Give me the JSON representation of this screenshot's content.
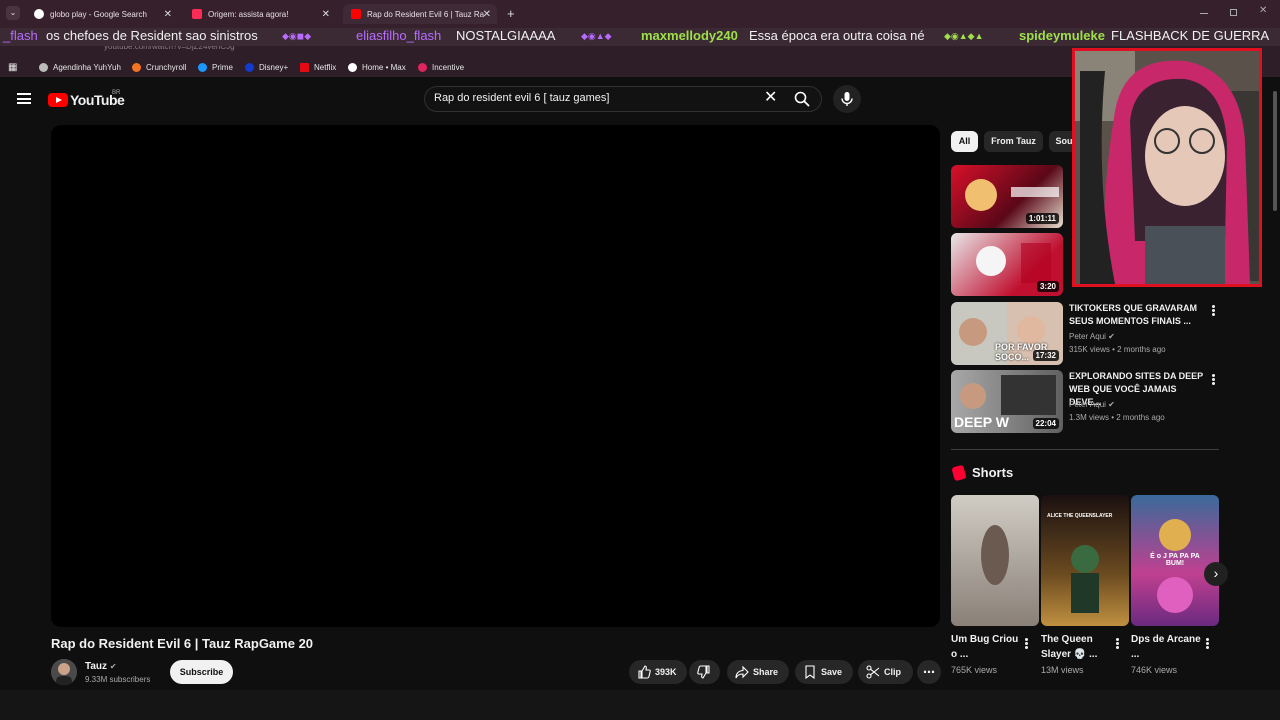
{
  "browser": {
    "tabs": [
      {
        "title": "globo play - Google Search"
      },
      {
        "title": "Origem: assista agora!"
      },
      {
        "title": "Rap do Resident Evil 6 | Tauz Ra"
      }
    ],
    "url": "youtube.com/watch?v=DjZ24vehCJg",
    "bookmarks": [
      "Agendinha YuhYuh",
      "Crunchyroll",
      "Prime",
      "Disney+",
      "Netflix",
      "Home • Max",
      "Incentive"
    ],
    "new_tab": "+"
  },
  "chat_overlay": {
    "messages": [
      {
        "user": "_flash",
        "text": "os chefoes de Resident sao sinistros",
        "color": "#b76cff"
      },
      {
        "user": "eliasfilho_flash",
        "text": "NOSTALGIAAAA",
        "color": "#b76cff"
      },
      {
        "user": "maxmellody240",
        "text": "Essa época era outra coisa né",
        "color": "#9ee04a"
      },
      {
        "user": "spideymuleke",
        "text": "FLASHBACK DE GUERRA",
        "color": "#9ee04a"
      }
    ]
  },
  "header": {
    "logo_text": "YouTube",
    "country": "BR",
    "search_value": "Rap do resident evil 6 [ tauz games]"
  },
  "video": {
    "title": "Rap do Resident Evil 6 | Tauz RapGame 20",
    "channel": "Tauz",
    "subscribers": "9.33M subscribers",
    "subscribe_label": "Subscribe",
    "likes": "393K",
    "share_label": "Share",
    "save_label": "Save",
    "clip_label": "Clip"
  },
  "chips": [
    "All",
    "From Tauz",
    "Sou"
  ],
  "recommendations": [
    {
      "title": "",
      "channel": "",
      "meta": "",
      "duration": "1:01:11"
    },
    {
      "title": "",
      "channel": "",
      "meta": "",
      "duration": "3:20"
    },
    {
      "title": "TIKTOKERS QUE GRAVARAM SEUS MOMENTOS FINAIS ...",
      "channel": "Peter Aqui",
      "meta": "315K views • 2 months ago",
      "duration": "17:32",
      "thumb_text": "POR FAVOR SOCO..."
    },
    {
      "title": "EXPLORANDO SITES DA DEEP WEB QUE VOCÊ JAMAIS DEVE...",
      "channel": "Peter Aqui",
      "meta": "1.3M views • 2 months ago",
      "duration": "22:04",
      "thumb_text": "DEEP W"
    }
  ],
  "shorts": {
    "heading": "Shorts",
    "items": [
      {
        "title": "Um Bug Criou o ...",
        "views": "765K views"
      },
      {
        "title": "The Queen Slayer 💀 ...",
        "views": "13M views",
        "thumb_text": "ALICE THE QUEENSLAYER"
      },
      {
        "title": "Dps de Arcane ...",
        "views": "746K views",
        "thumb_text": "É o J PA PA PA BUM!"
      }
    ]
  },
  "colors": {
    "accent": "#ff0000",
    "chrome": "#35202c",
    "cam_border": "#e01020"
  }
}
